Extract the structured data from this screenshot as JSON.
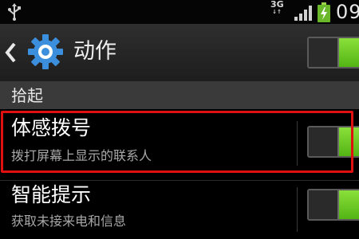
{
  "status_bar": {
    "network": "3G",
    "network_sub": "↓↑",
    "time": "09",
    "icons": [
      "usb-icon",
      "signal-icon",
      "battery-charging-icon"
    ]
  },
  "action_bar": {
    "title": "动作",
    "icons": [
      "back-icon",
      "gear-icon"
    ],
    "master_toggle": true
  },
  "section": {
    "header": "拾起"
  },
  "items": [
    {
      "title": "体感拨号",
      "subtitle": "拨打屏幕上显示的联系人",
      "enabled": true
    },
    {
      "title": "智能提示",
      "subtitle": "获取未接来电和信息",
      "enabled": true
    }
  ],
  "colors": {
    "toggle_on": "#6ccc24",
    "highlight": "#e01010",
    "gear": "#3b8fdc"
  }
}
